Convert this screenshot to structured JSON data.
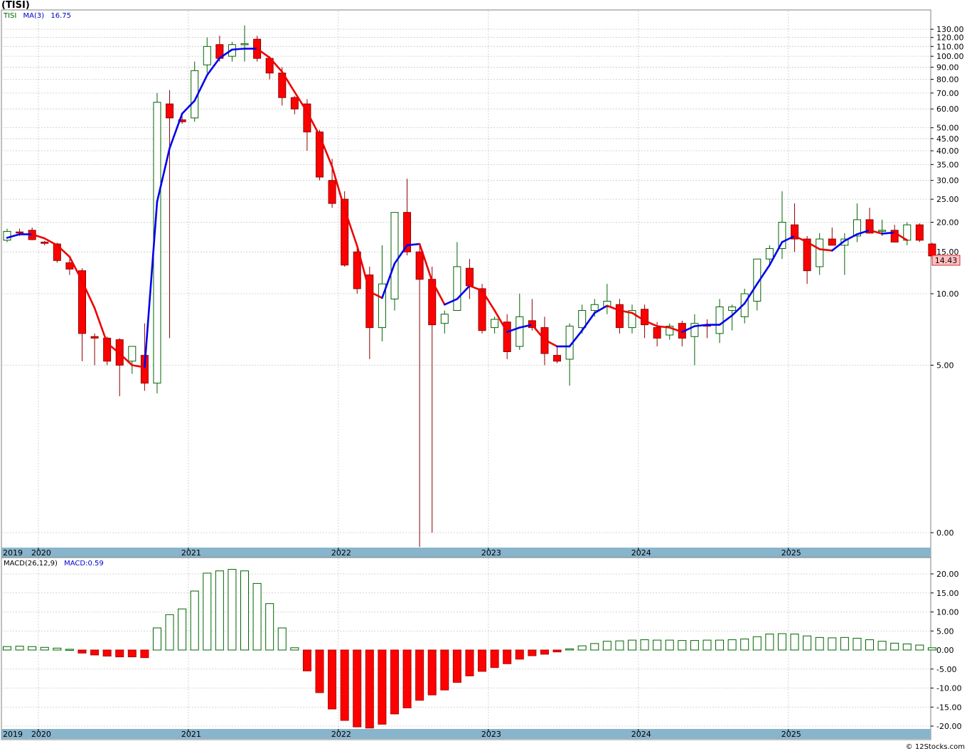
{
  "title": "(TISI)",
  "price_legend": {
    "symbol": "TISI",
    "ma_label": "MA(3)",
    "ma_value": "16.75"
  },
  "macd_legend": {
    "label": "MACD(26,12,9)",
    "value_label": "MACD:0.59"
  },
  "last_price_label": "14.43",
  "footer": "© 12Stocks.com",
  "colors": {
    "up": "#006400",
    "down": "#ff0000",
    "ma_up": "#0000ee",
    "ma_down": "#ee0000",
    "grid": "#c8c8c8",
    "axis_band": "#88b4cc",
    "price_box": "#ffc0c0"
  },
  "chart_data": [
    {
      "type": "candlestick",
      "scale": "log",
      "period": "monthly",
      "y_ticks": [
        "130.00",
        "120.00",
        "110.00",
        "100.00",
        "90.00",
        "80.00",
        "70.00",
        "60.00",
        "50.00",
        "45.00",
        "40.00",
        "35.00",
        "30.00",
        "25.00",
        "20.00",
        "15.00",
        "10.00",
        "5.00",
        "0.00"
      ],
      "year_labels": [
        "2019",
        "2020",
        "2021",
        "2022",
        "2023",
        "2024",
        "2025"
      ],
      "months": [
        "2019-10",
        "2019-11",
        "2019-12",
        "2020-01",
        "2020-02",
        "2020-03",
        "2020-04",
        "2020-05",
        "2020-06",
        "2020-07",
        "2020-08",
        "2020-09",
        "2020-10",
        "2020-11",
        "2020-12",
        "2021-01",
        "2021-02",
        "2021-03",
        "2021-04",
        "2021-05",
        "2021-06",
        "2021-07",
        "2021-08",
        "2021-09",
        "2021-10",
        "2021-11",
        "2021-12",
        "2022-01",
        "2022-02",
        "2022-03",
        "2022-04",
        "2022-05",
        "2022-06",
        "2022-07",
        "2022-08",
        "2022-09",
        "2022-10",
        "2022-11",
        "2022-12",
        "2023-01",
        "2023-02",
        "2023-03",
        "2023-04",
        "2023-05",
        "2023-06",
        "2023-07",
        "2023-08",
        "2023-09",
        "2023-10",
        "2023-11",
        "2023-12",
        "2024-01",
        "2024-02",
        "2024-03",
        "2024-04",
        "2024-05",
        "2024-06",
        "2024-07",
        "2024-08",
        "2024-09",
        "2024-10",
        "2024-11",
        "2024-12",
        "2025-01",
        "2025-02",
        "2025-03",
        "2025-04",
        "2025-05",
        "2025-06",
        "2025-07",
        "2025-08",
        "2025-09",
        "2025-10"
      ],
      "ohlc": [
        [
          16.8,
          18.8,
          16.5,
          18.3
        ],
        [
          18.2,
          18.8,
          17.5,
          18.1
        ],
        [
          18.5,
          19.0,
          16.8,
          16.9
        ],
        [
          16.5,
          16.7,
          16.0,
          16.3
        ],
        [
          16.2,
          16.4,
          13.5,
          13.8
        ],
        [
          13.5,
          14.0,
          12.0,
          12.7
        ],
        [
          12.5,
          12.8,
          5.2,
          6.8
        ],
        [
          6.6,
          6.8,
          5.0,
          6.5
        ],
        [
          6.5,
          6.6,
          5.0,
          5.2
        ],
        [
          6.4,
          6.5,
          3.7,
          5.0
        ],
        [
          5.2,
          5.6,
          4.6,
          6.0
        ],
        [
          5.5,
          7.5,
          3.9,
          4.2
        ],
        [
          4.2,
          70.0,
          3.8,
          64.0
        ],
        [
          63.0,
          72.0,
          6.5,
          55.0
        ],
        [
          54.0,
          56.0,
          52.0,
          53.0
        ],
        [
          55.0,
          95.0,
          53.0,
          87.0
        ],
        [
          92.0,
          120.0,
          85.0,
          110.0
        ],
        [
          112.0,
          122.0,
          95.0,
          98.0
        ],
        [
          100.0,
          115.0,
          95.0,
          112.0
        ],
        [
          112.0,
          135.0,
          95.0,
          113.0
        ],
        [
          118.0,
          122.0,
          95.0,
          98.0
        ],
        [
          98.0,
          100.0,
          80.0,
          85.0
        ],
        [
          85.0,
          90.0,
          62.0,
          67.0
        ],
        [
          67.0,
          68.0,
          57.0,
          60.0
        ],
        [
          63.0,
          66.0,
          40.0,
          48.0
        ],
        [
          48.0,
          49.0,
          30.0,
          31.0
        ],
        [
          30.0,
          37.0,
          23.0,
          24.0
        ],
        [
          25.0,
          27.0,
          13.0,
          13.2
        ],
        [
          15.0,
          15.5,
          10.0,
          10.5
        ],
        [
          12.0,
          13.0,
          5.3,
          7.2
        ],
        [
          7.2,
          16.0,
          6.3,
          11.0
        ],
        [
          9.5,
          22.0,
          8.5,
          22.0
        ],
        [
          22.0,
          30.5,
          14.5,
          15.0
        ],
        [
          15.0,
          16.0,
          0.12,
          11.5
        ],
        [
          11.5,
          13.0,
          0.02,
          7.4
        ],
        [
          7.5,
          8.5,
          6.8,
          8.2
        ],
        [
          8.5,
          16.5,
          8.5,
          13.0
        ],
        [
          12.8,
          14.0,
          9.5,
          10.8
        ],
        [
          10.5,
          11.0,
          6.8,
          7.0
        ],
        [
          7.2,
          8.0,
          6.8,
          7.8
        ],
        [
          7.6,
          8.2,
          5.3,
          5.7
        ],
        [
          6.0,
          10.0,
          5.8,
          8.0
        ],
        [
          7.7,
          9.5,
          7.0,
          7.2
        ],
        [
          7.2,
          8.0,
          5.0,
          5.6
        ],
        [
          5.5,
          6.0,
          5.1,
          5.2
        ],
        [
          5.3,
          7.5,
          4.1,
          7.3
        ],
        [
          7.2,
          9.0,
          6.8,
          8.5
        ],
        [
          8.5,
          9.5,
          8.0,
          9.0
        ],
        [
          8.8,
          11.0,
          8.2,
          9.3
        ],
        [
          9.0,
          9.5,
          6.8,
          7.2
        ],
        [
          7.2,
          9.0,
          6.8,
          8.5
        ],
        [
          8.6,
          9.0,
          6.5,
          7.4
        ],
        [
          7.2,
          7.6,
          6.0,
          6.5
        ],
        [
          6.7,
          7.5,
          6.4,
          7.3
        ],
        [
          7.5,
          7.7,
          6.0,
          6.5
        ],
        [
          6.6,
          8.2,
          5.0,
          7.5
        ],
        [
          7.4,
          7.8,
          6.5,
          7.3
        ],
        [
          6.8,
          9.5,
          6.2,
          8.8
        ],
        [
          8.5,
          9.0,
          7.0,
          8.8
        ],
        [
          8.0,
          10.5,
          7.5,
          10.0
        ],
        [
          9.3,
          14.0,
          8.5,
          14.0
        ],
        [
          14.0,
          16.0,
          13.0,
          15.5
        ],
        [
          15.5,
          27.0,
          14.0,
          20.0
        ],
        [
          19.5,
          24.0,
          15.0,
          17.0
        ],
        [
          17.0,
          17.5,
          11.0,
          12.5
        ],
        [
          13.0,
          18.0,
          12.0,
          17.0
        ],
        [
          17.0,
          19.0,
          16.0,
          16.0
        ],
        [
          16.0,
          18.0,
          12.0,
          17.0
        ],
        [
          17.5,
          24.0,
          16.5,
          20.5
        ],
        [
          20.5,
          23.0,
          18.5,
          18.0
        ],
        [
          18.5,
          20.5,
          17.5,
          18.5
        ],
        [
          18.5,
          19.5,
          16.5,
          16.5
        ],
        [
          16.8,
          20.0,
          16.0,
          19.5
        ],
        [
          19.5,
          19.8,
          16.5,
          16.8
        ],
        [
          16.2,
          16.4,
          14.0,
          14.43
        ]
      ],
      "ma3": [
        17.2,
        17.8,
        17.8,
        17.1,
        16.0,
        14.3,
        11.3,
        8.7,
        6.2,
        5.6,
        5.0,
        4.9,
        24.4,
        41.0,
        57.3,
        65.0,
        83.3,
        98.3,
        106.7,
        107.7,
        107.7,
        98.7,
        86.0,
        70.7,
        58.3,
        46.3,
        34.3,
        22.7,
        15.9,
        10.2,
        9.6,
        13.4,
        16.0,
        16.2,
        11.3,
        9.0,
        9.5,
        10.8,
        10.3,
        8.5,
        6.9,
        7.2,
        7.4,
        6.4,
        6.0,
        6.0,
        7.0,
        8.3,
        8.9,
        8.5,
        8.3,
        7.7,
        7.3,
        7.2,
        6.9,
        7.3,
        7.4,
        7.4,
        8.1,
        9.1,
        11.0,
        13.2,
        16.5,
        17.5,
        16.5,
        15.4,
        15.2,
        16.7,
        17.8,
        18.5,
        17.9,
        18.1,
        16.8
      ]
    },
    {
      "type": "bar",
      "name": "MACD",
      "y_ticks": [
        "20.00",
        "15.00",
        "10.00",
        "5.00",
        "0.00",
        "-5.00",
        "-10.00",
        "-15.00",
        "-20.00"
      ],
      "ylim": [
        -21,
        22.5
      ],
      "values": [
        0.9,
        1.0,
        0.9,
        0.7,
        0.5,
        0.2,
        -0.8,
        -1.3,
        -1.6,
        -1.8,
        -1.8,
        -2.0,
        5.8,
        9.3,
        10.8,
        15.5,
        20.2,
        20.8,
        21.2,
        20.8,
        17.5,
        12.2,
        5.8,
        0.6,
        -5.5,
        -11.2,
        -15.5,
        -18.5,
        -20.2,
        -20.5,
        -19.5,
        -16.8,
        -15.2,
        -13.2,
        -11.8,
        -10.5,
        -8.5,
        -6.8,
        -5.6,
        -4.6,
        -3.6,
        -2.4,
        -1.5,
        -1.1,
        -0.5,
        0.3,
        1.1,
        1.7,
        2.3,
        2.4,
        2.6,
        2.7,
        2.6,
        2.6,
        2.5,
        2.5,
        2.6,
        2.6,
        2.7,
        2.9,
        3.5,
        4.2,
        4.3,
        4.2,
        3.7,
        3.3,
        3.2,
        3.3,
        3.1,
        2.7,
        2.3,
        1.8,
        1.6,
        1.3,
        0.59
      ]
    }
  ]
}
